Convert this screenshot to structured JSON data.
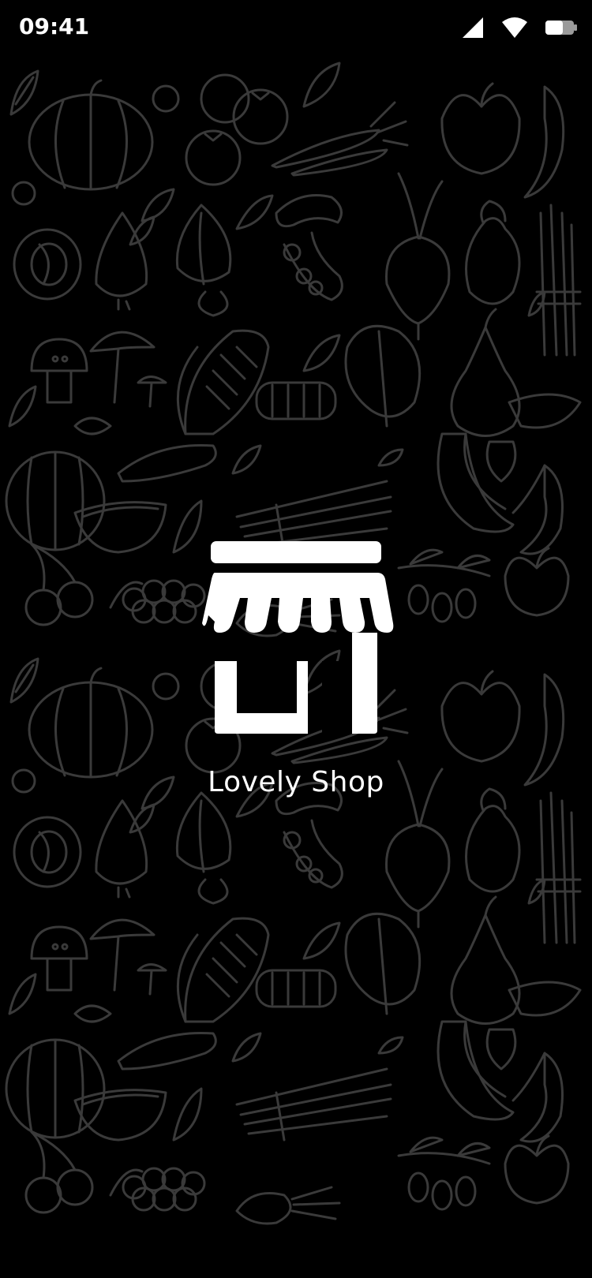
{
  "status_bar": {
    "time": "09:41",
    "icons": [
      "cellular-signal-icon",
      "wifi-icon",
      "battery-icon"
    ]
  },
  "background": {
    "pattern": "hand-drawn fruits and vegetables doodle pattern",
    "stroke_color": "#3a3a3a"
  },
  "splash": {
    "logo_icon": "storefront-icon",
    "app_name": "Lovely Shop"
  },
  "colors": {
    "background": "#000000",
    "foreground": "#ffffff"
  }
}
